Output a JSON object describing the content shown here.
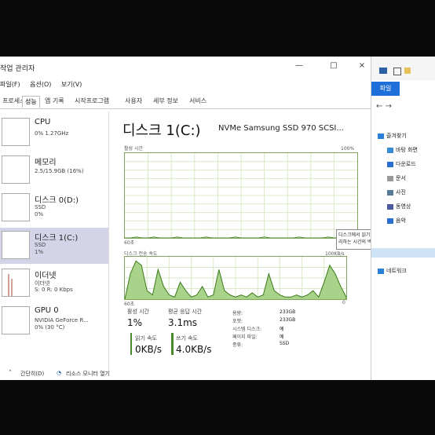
{
  "window": {
    "title": "작업 관리자",
    "minimize": "—",
    "maximize": "□",
    "close": "×"
  },
  "menu": [
    "파일(F)",
    "옵션(O)",
    "보기(V)"
  ],
  "tabs": [
    "프로세스",
    "성능",
    "앱 기록",
    "시작프로그램",
    "사용자",
    "세부 정보",
    "서비스"
  ],
  "active_tab": "성능",
  "sidebar": [
    {
      "title": "CPU",
      "sub1": "0% 1.27GHz",
      "sub2": ""
    },
    {
      "title": "메모리",
      "sub1": "2.5/15.9GB (16%)",
      "sub2": ""
    },
    {
      "title": "디스크 0(D:)",
      "sub1": "SSD",
      "sub2": "0%"
    },
    {
      "title": "디스크 1(C:)",
      "sub1": "SSD",
      "sub2": "1%"
    },
    {
      "title": "이더넷",
      "sub1": "이더넷",
      "sub2": "S: 0 R: 0 Kbps"
    },
    {
      "title": "GPU 0",
      "sub1": "NVIDIA GeForce R...",
      "sub2": "0% (30 °C)"
    }
  ],
  "main": {
    "title": "디스크 1(C:)",
    "model": "NVMe Samsung SSD 970 SCSI...",
    "active_time_label": "활성 시간",
    "pct_100": "100%",
    "sec_60": "60초",
    "zero": "0",
    "transfer_label": "디스크 전송 속도",
    "transfer_max": "100KB/s",
    "tooltip": "디스크에서 읽기 또는 쓰기 요청을 처리하는 시간의 백분율"
  },
  "stats": {
    "active_time_label": "활성 시간",
    "active_time_value": "1%",
    "avg_response_label": "평균 응답 시간",
    "avg_response_value": "3.1ms",
    "read_label": "읽기 속도",
    "read_value": "0KB/s",
    "write_label": "쓰기 속도",
    "write_value": "4.0KB/s"
  },
  "details": [
    {
      "k": "용량:",
      "v": "233GB"
    },
    {
      "k": "포맷:",
      "v": "233GB"
    },
    {
      "k": "시스템 디스크:",
      "v": "예"
    },
    {
      "k": "페이지 파일:",
      "v": "예"
    },
    {
      "k": "종류:",
      "v": "SSD"
    }
  ],
  "footer": {
    "brief": "간단히(D)",
    "resmon": "리소스 모니터 열기"
  },
  "explorer": {
    "file_tab": "파일",
    "quick_access": "즐겨찾기",
    "items": [
      "바탕 화면",
      "다운로드",
      "문서",
      "사진",
      "동영상",
      "음악"
    ],
    "network": "네트워크"
  },
  "chart_data": {
    "type": "line",
    "active_time_series": [
      0,
      0,
      1,
      0,
      0,
      1,
      0,
      0,
      0,
      1,
      0,
      0,
      0,
      0,
      1,
      0,
      0,
      0,
      0,
      1,
      0,
      0,
      0,
      0,
      1,
      0,
      0,
      0,
      0,
      0,
      1,
      0,
      0,
      0,
      0,
      1,
      0,
      0,
      0,
      3,
      1
    ],
    "transfer_series": [
      0,
      60,
      90,
      80,
      20,
      10,
      70,
      30,
      10,
      5,
      40,
      20,
      5,
      10,
      30,
      5,
      10,
      70,
      20,
      10,
      5,
      10,
      5,
      15,
      5,
      10,
      60,
      20,
      10,
      5,
      5,
      10,
      5,
      10,
      20,
      5,
      40,
      80,
      60,
      30,
      5
    ]
  }
}
